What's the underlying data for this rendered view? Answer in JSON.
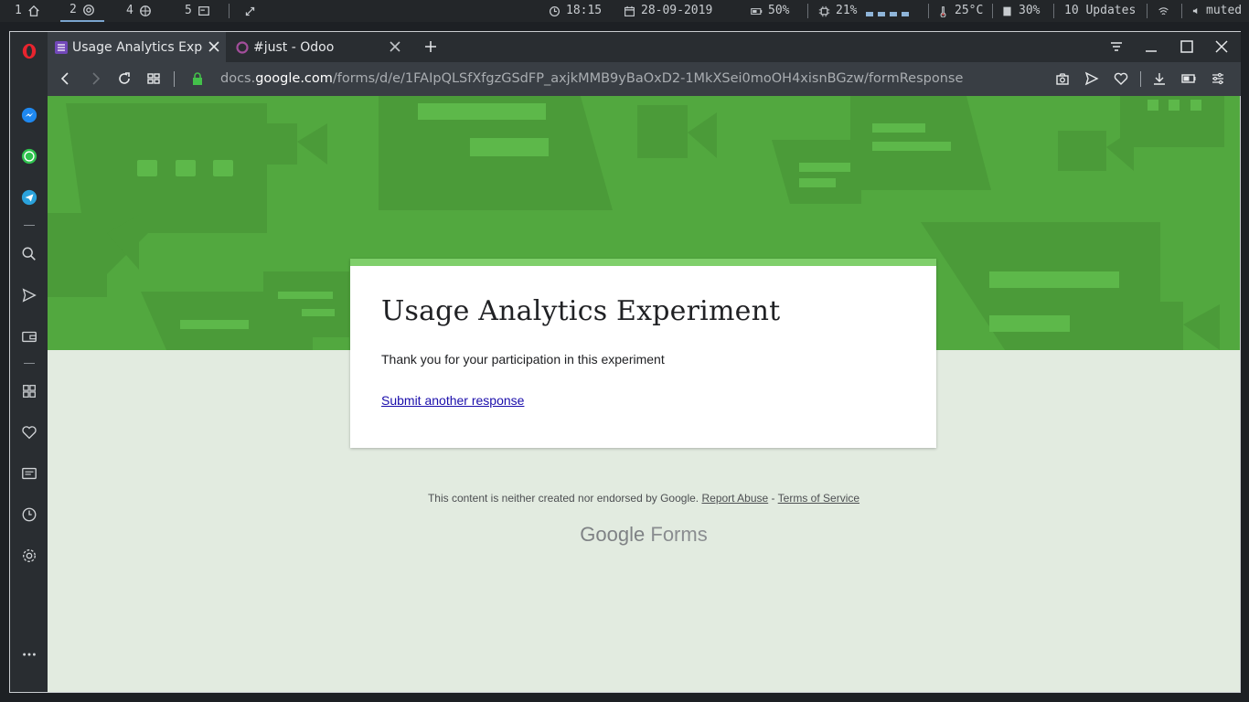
{
  "system_bar": {
    "workspaces": [
      {
        "num": "1",
        "icon": "home-icon"
      },
      {
        "num": "2",
        "icon": "chrome-icon",
        "active": true
      },
      {
        "num": "4",
        "icon": "globe-icon"
      },
      {
        "num": "5",
        "icon": "terminal-icon"
      }
    ],
    "time": "18:15",
    "date": "28-09-2019",
    "battery": "50%",
    "cpu": "21%",
    "temperature": "25°C",
    "memory": "30%",
    "updates": "10 Updates",
    "volume": "muted"
  },
  "browser": {
    "tabs": [
      {
        "title": "Usage Analytics Expe",
        "active": true
      },
      {
        "title": "#just - Odoo",
        "active": false
      }
    ],
    "url_domain_prefix": "docs.",
    "url_domain": "google.com",
    "url_path": "/forms/d/e/1FAIpQLSfXfgzGSdFP_axjkMMB9yBaOxD2-1MkXSei0moOH4xisnBGzw/formResponse"
  },
  "form": {
    "title": "Usage Analytics Experiment",
    "message": "Thank you for your participation in this experiment",
    "link": "Submit another response"
  },
  "footer": {
    "disclaimer": "This content is neither created nor endorsed by Google.",
    "report_abuse": "Report Abuse",
    "dash": "-",
    "terms": "Terms of Service",
    "brand_google": "Google",
    "brand_forms": "Forms"
  },
  "colors": {
    "banner": "#52a83f",
    "accent": "#7fcf6b",
    "page_bg": "#e2ebe0"
  }
}
